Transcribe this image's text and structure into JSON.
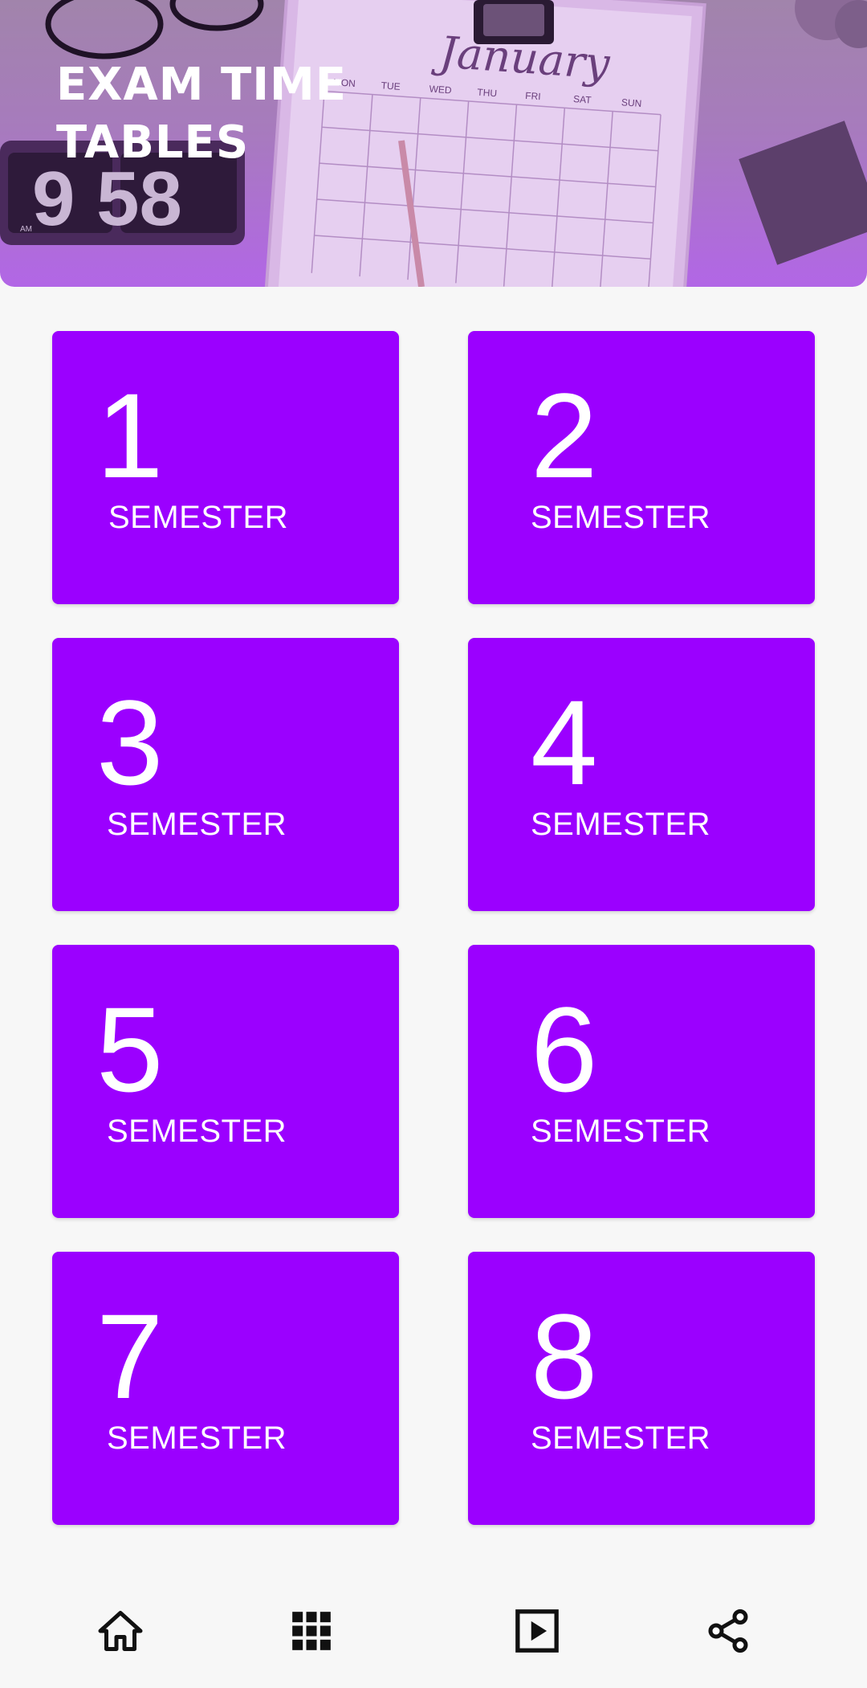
{
  "header": {
    "title": "EXAM TIME\nTABLES",
    "image": {
      "calendar_month": "January",
      "weekdays": [
        "MON",
        "TUE",
        "WED",
        "THU",
        "FRI",
        "SAT",
        "SUN"
      ],
      "clock": "9 58",
      "clock_ampm": "AM"
    }
  },
  "cards": [
    {
      "number": "1",
      "label": "SEMESTER"
    },
    {
      "number": "2",
      "label": "SEMESTER"
    },
    {
      "number": "3",
      "label": "SEMESTER"
    },
    {
      "number": "4",
      "label": "SEMESTER"
    },
    {
      "number": "5",
      "label": "SEMESTER"
    },
    {
      "number": "6",
      "label": "SEMESTER"
    },
    {
      "number": "7",
      "label": "SEMESTER"
    },
    {
      "number": "8",
      "label": "SEMESTER"
    }
  ],
  "bottom_nav": [
    {
      "icon": "home-icon"
    },
    {
      "icon": "grid-icon"
    },
    {
      "icon": "play-icon"
    },
    {
      "icon": "share-icon"
    }
  ],
  "colors": {
    "card_bg": "#9b00ff",
    "card_text": "#ffffff",
    "page_bg": "#f7f7f7",
    "icon": "#111111"
  }
}
